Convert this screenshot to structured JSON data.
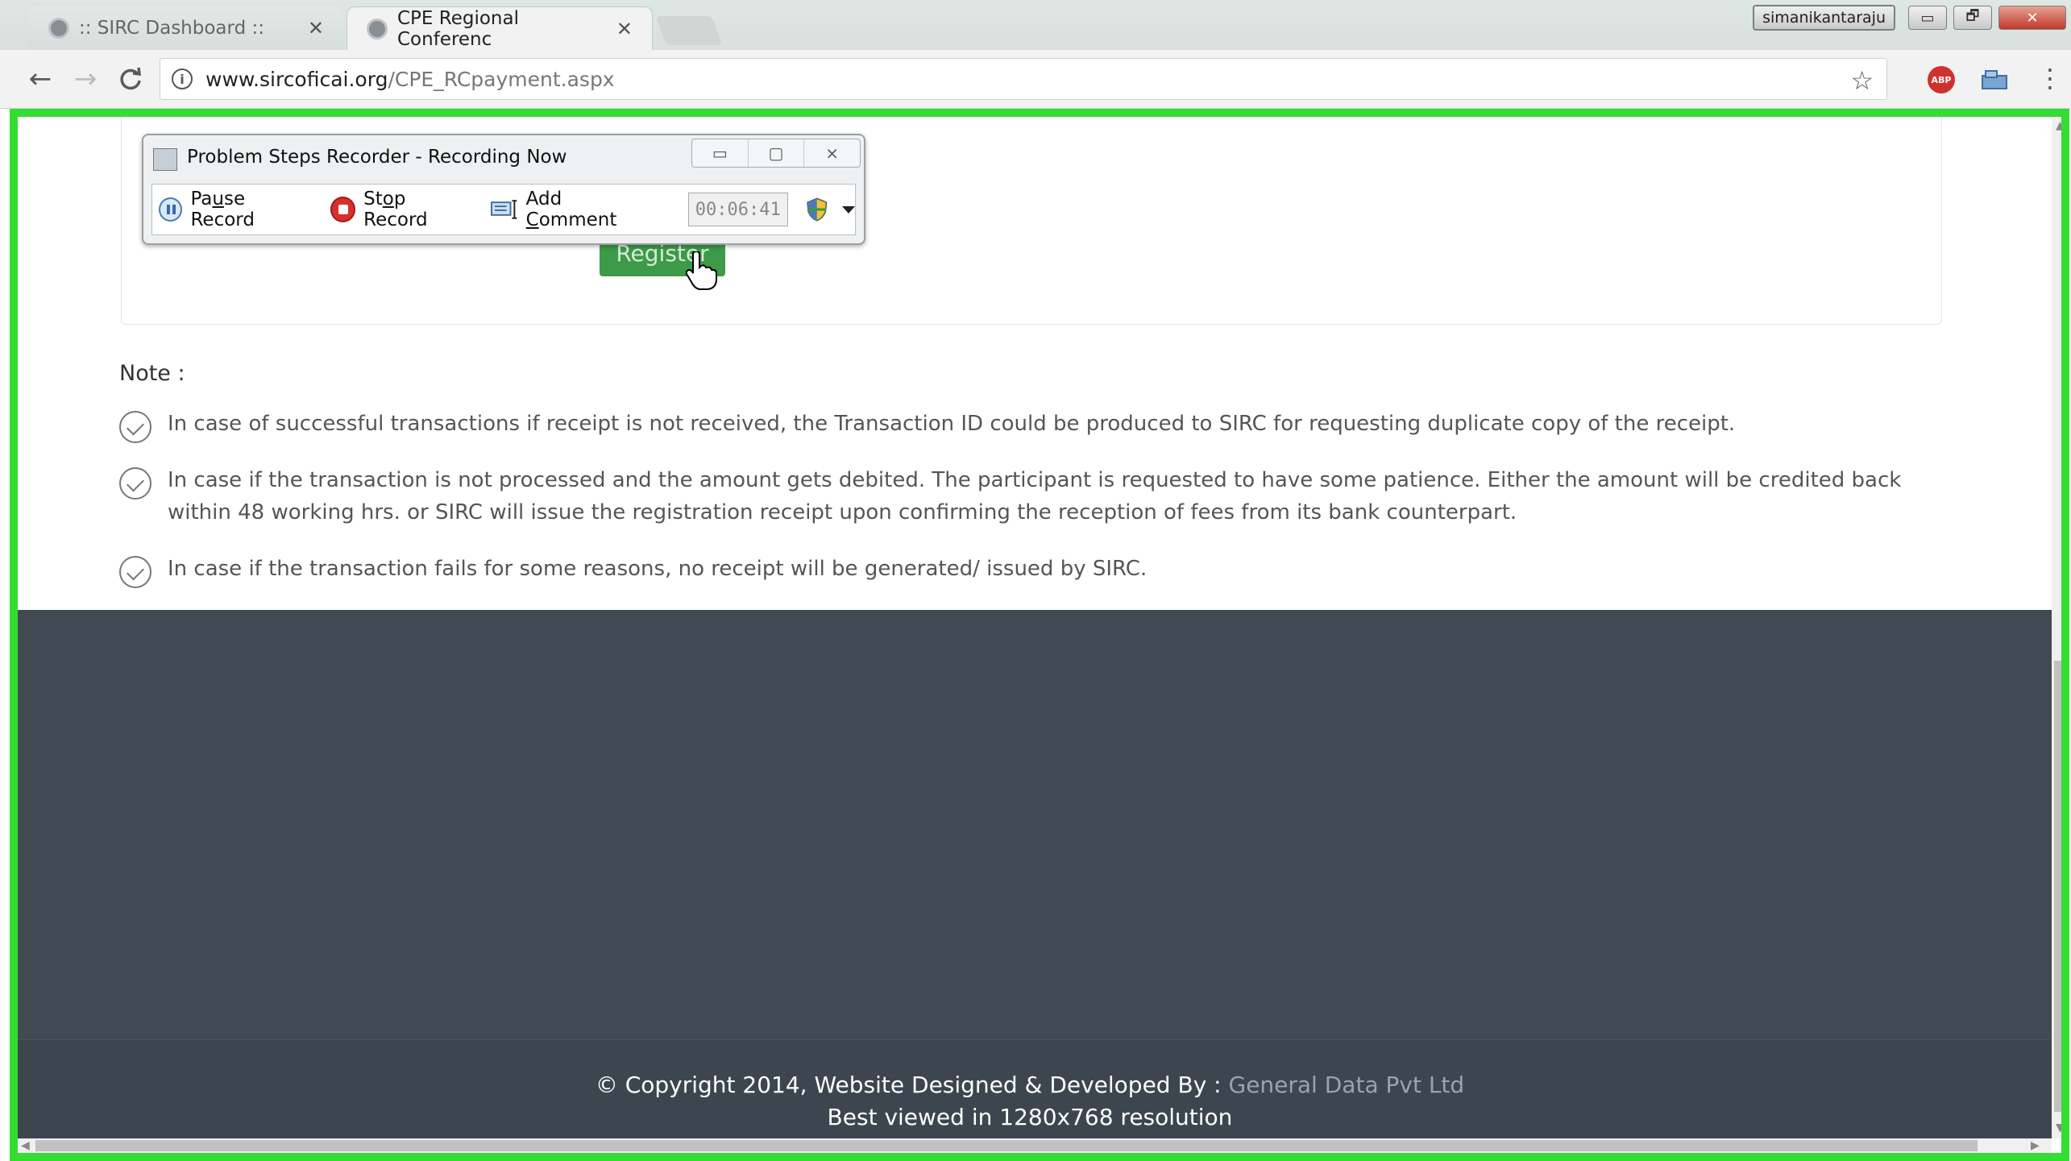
{
  "browser": {
    "tabs": [
      {
        "title": ":: SIRC Dashboard ::",
        "close": "✕"
      },
      {
        "title": "CPE Regional Conferenc",
        "close": "✕"
      }
    ],
    "window": {
      "user": "simanikantaraju",
      "minimize": "▭",
      "restore": "🗗",
      "close": "✕"
    },
    "nav": {
      "back": "←",
      "forward": "→",
      "reload": "C"
    },
    "url_host": "www.sircoficai.org",
    "url_path": "/CPE_RCpayment.aspx",
    "star": "☆",
    "abp_label": "ABP",
    "menu": "⋮"
  },
  "psr": {
    "title": "Problem Steps Recorder - Recording Now",
    "pause_pre": "Pa",
    "pause_u": "u",
    "pause_post": "se Record",
    "stop_pre": "St",
    "stop_u": "o",
    "stop_post": "p Record",
    "comment_pre": "Add ",
    "comment_u": "C",
    "comment_post": "omment",
    "timer": "00:06:41",
    "controls": {
      "minimize": "▭",
      "maximize": "▢",
      "close": "⨯"
    }
  },
  "form": {
    "register_label": "Register"
  },
  "notes": {
    "title": "Note :",
    "items": [
      "In case of successful transactions if receipt is not received, the Transaction ID could be produced to SIRC for requesting duplicate copy of the receipt.",
      "In case if the transaction is not processed and the amount gets debited. The participant is requested to have some patience. Either the amount will be credited back within 48 working hrs. or SIRC will issue the registration receipt upon confirming the reception of fees from its bank counterpart.",
      "In case if the transaction fails for some reasons, no receipt will be generated/ issued by SIRC."
    ]
  },
  "footer": {
    "copyright": "© Copyright 2014, Website Designed & Developed By :",
    "developer": " General Data Pvt Ltd",
    "best_viewed": "Best viewed in 1280x768 resolution"
  },
  "colors": {
    "accent_green_frame": "#33dd33",
    "register_button": "#3d9a48",
    "footer_bg": "#414a52"
  }
}
